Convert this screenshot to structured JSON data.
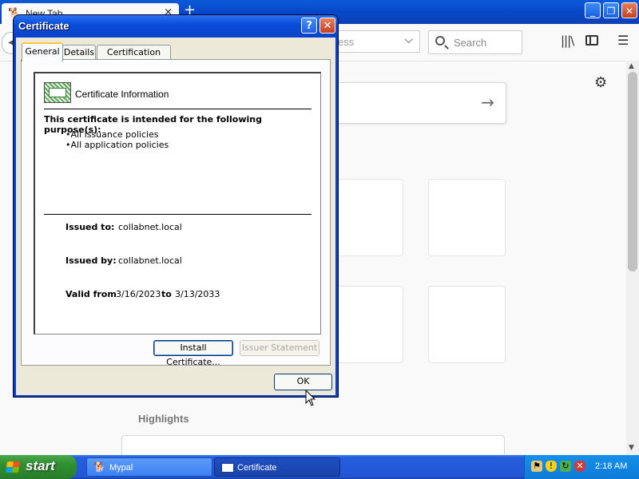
{
  "browser": {
    "tab_title": "New Tab",
    "tab_close": "×",
    "new_tab": "+",
    "url_placeholder_fragment": "ess",
    "search_placeholder": "Search",
    "highlights_label": "Highlights",
    "window_buttons": {
      "minimize": "_",
      "maximize": "❐",
      "close": "✕"
    }
  },
  "dialog": {
    "title": "Certificate",
    "help_button": "?",
    "close_button": "✕",
    "tabs": [
      {
        "label": "General",
        "active": true
      },
      {
        "label": "Details",
        "active": false
      },
      {
        "label": "Certification Path",
        "active": false
      }
    ],
    "heading": "Certificate Information",
    "purpose_title": "This certificate is intended for the following purpose(s):",
    "purposes": [
      "All issuance policies",
      "All application policies"
    ],
    "issued_to_label": "Issued to:",
    "issued_to": "collabnet.local",
    "issued_by_label": "Issued by:",
    "issued_by": "collabnet.local",
    "valid_from_label": "Valid from",
    "valid_from": "3/16/2023",
    "valid_to_label": "to",
    "valid_to": "3/13/2033",
    "install_button": "Install Certificate...",
    "issuer_button": "Issuer Statement",
    "ok_button": "OK"
  },
  "taskbar": {
    "start_label": "start",
    "tasks": [
      {
        "label": "Mypal",
        "active": false
      },
      {
        "label": "Certificate",
        "active": true
      }
    ],
    "clock": "2:18 AM"
  },
  "colors": {
    "xp_blue": "#0842c4",
    "dialog_face": "#ece9d8",
    "start_green": "#2f8f2f",
    "tab_highlight": "#ffc83c"
  }
}
